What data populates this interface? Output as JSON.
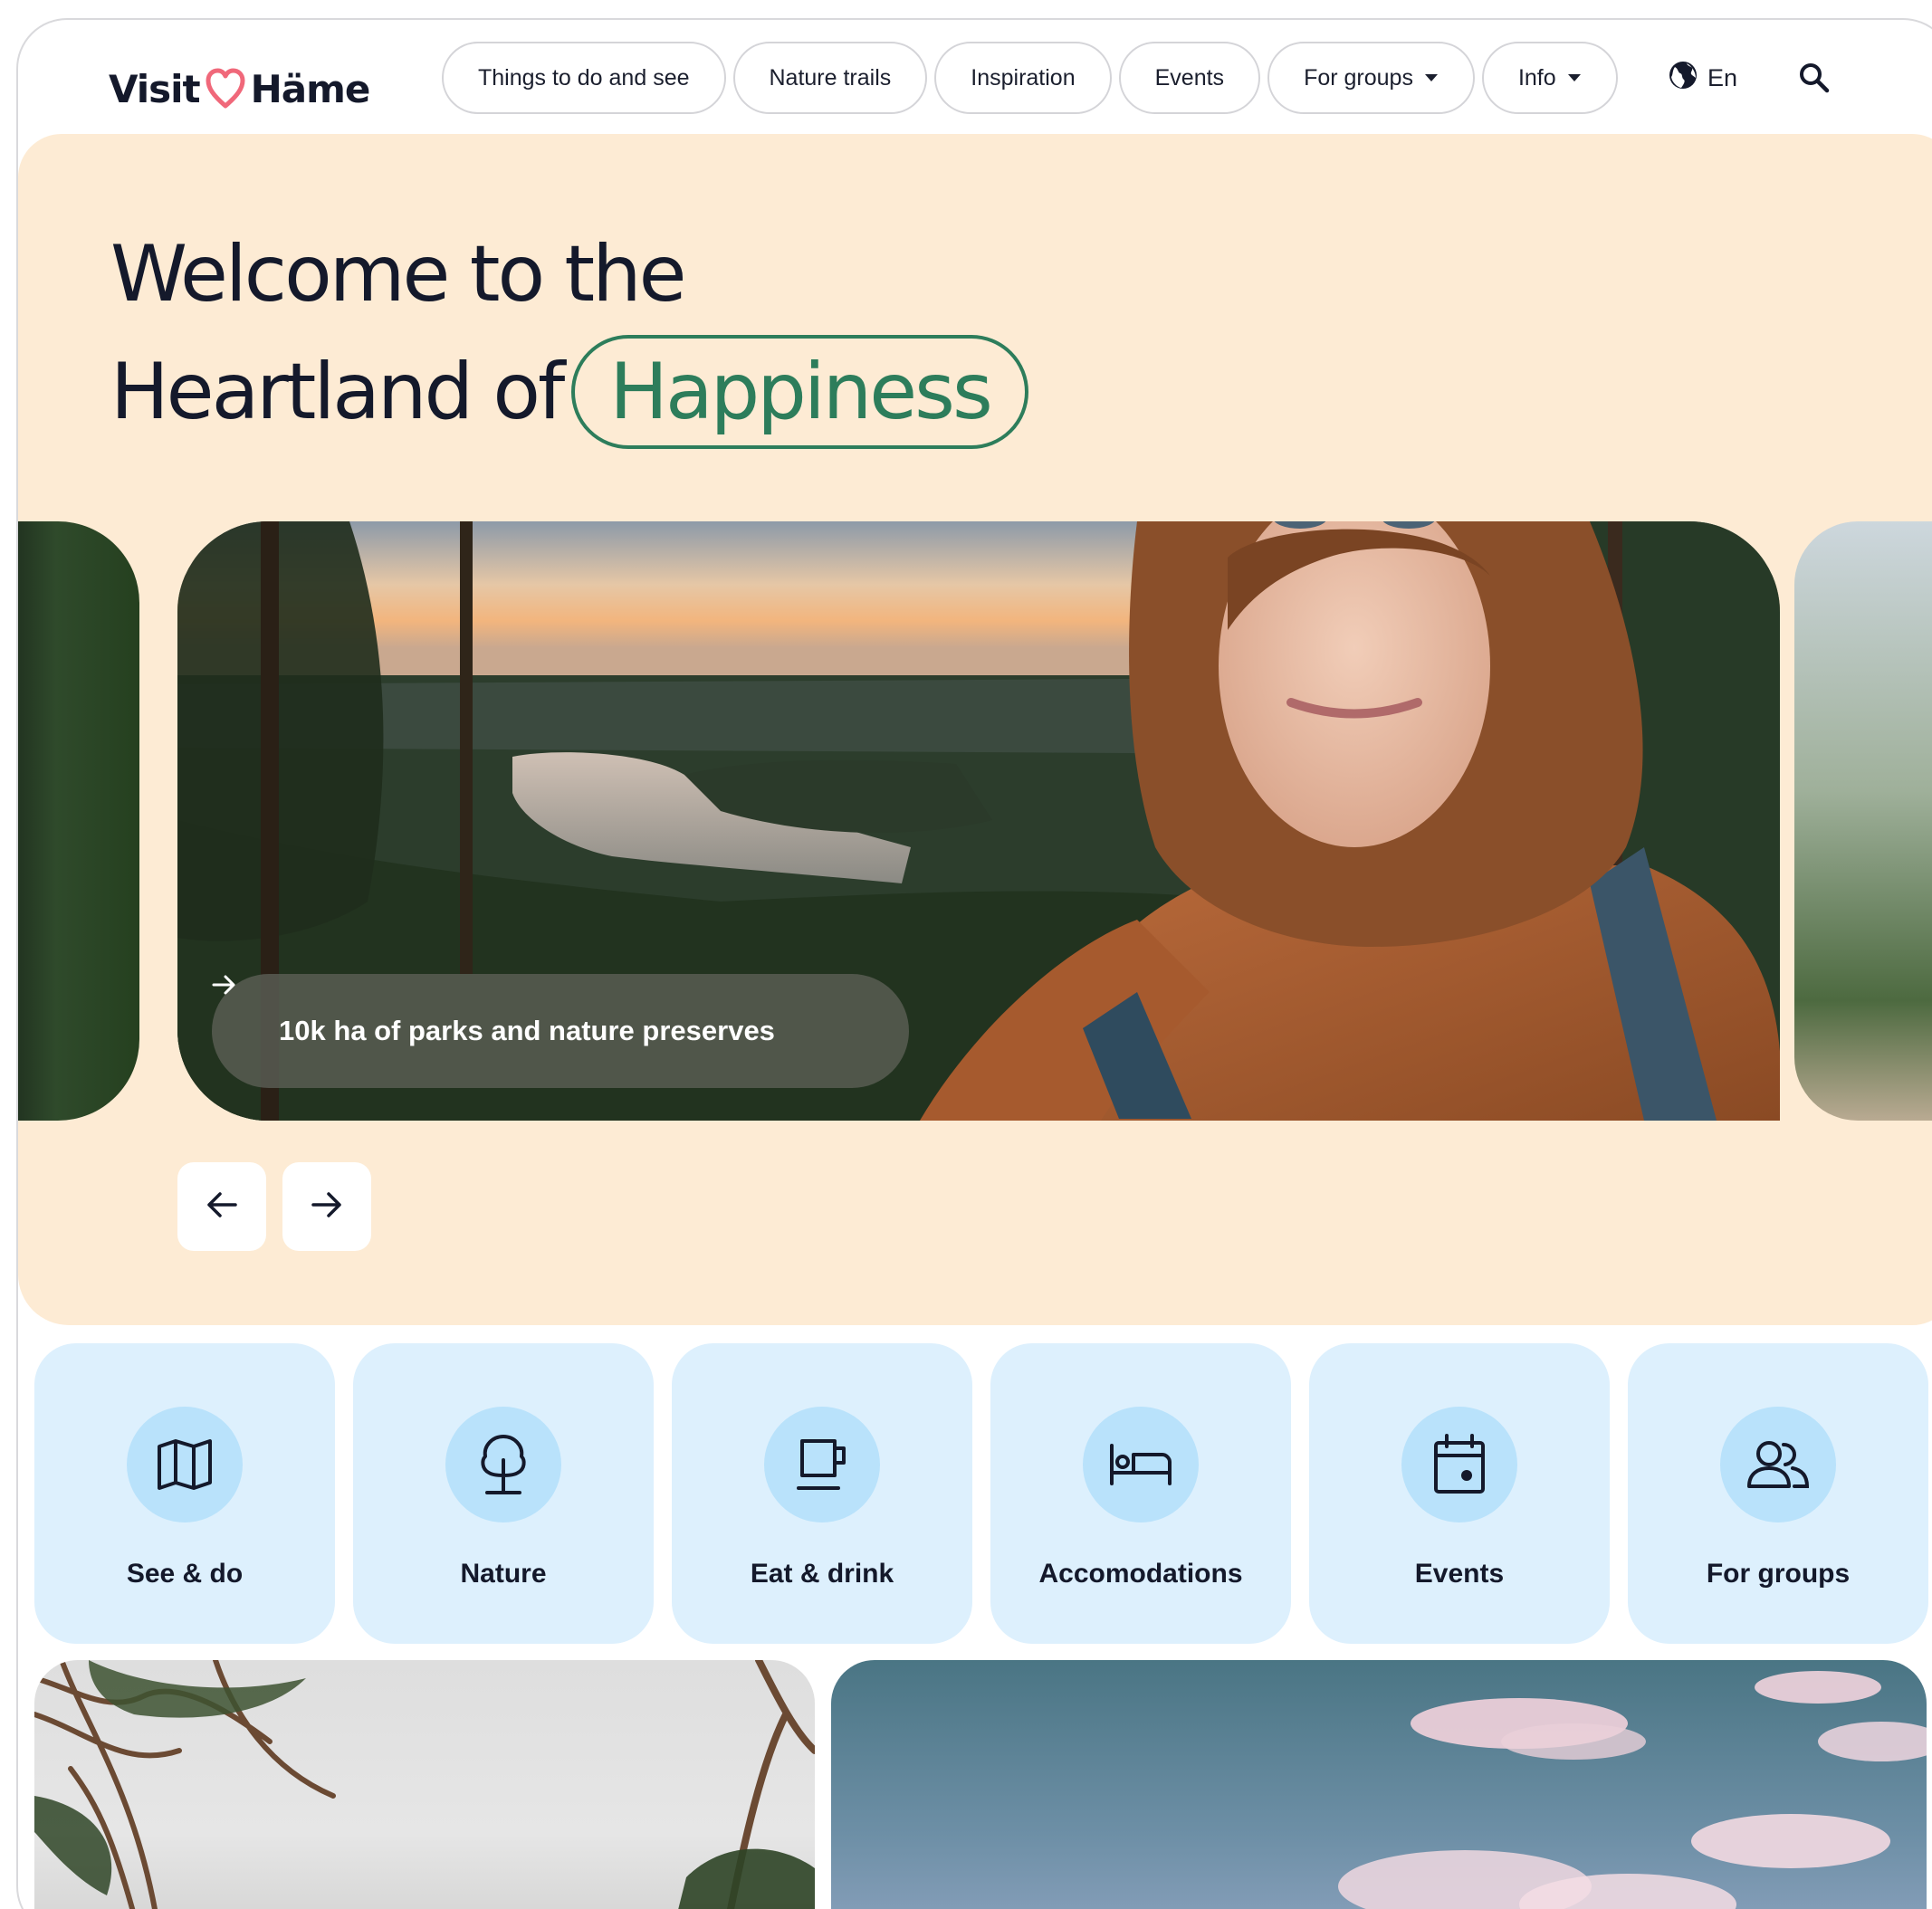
{
  "brand": {
    "logo_part1": "Visit",
    "logo_part2": "Häme",
    "heart_color": "#f0687a"
  },
  "nav": {
    "items": [
      {
        "label": "Things to do and see"
      },
      {
        "label": "Nature trails"
      },
      {
        "label": "Inspiration"
      },
      {
        "label": "Events"
      },
      {
        "label": "For groups",
        "has_dropdown": true
      },
      {
        "label": "Info",
        "has_dropdown": true
      }
    ],
    "language": "En",
    "language_icon": "globe-icon",
    "search_icon": "search-icon"
  },
  "hero": {
    "title_line1": "Welcome to the",
    "title_line2": "Heartland of",
    "title_highlight": "Happiness",
    "background_color": "#fdebd4",
    "highlight_color": "#2d7d5b",
    "slide_caption": "10k ha of parks and nature preserves",
    "slide_caption_icon": "arrow-right-icon",
    "prev_icon": "arrow-left-icon",
    "next_icon": "arrow-right-icon"
  },
  "categories": [
    {
      "label": "See & do",
      "icon": "map-icon"
    },
    {
      "label": "Nature",
      "icon": "tree-icon"
    },
    {
      "label": "Eat & drink",
      "icon": "coffee-cup-icon"
    },
    {
      "label": "Accomodations",
      "icon": "bed-icon"
    },
    {
      "label": "Events",
      "icon": "calendar-icon"
    },
    {
      "label": "For groups",
      "icon": "group-icon"
    }
  ],
  "colors": {
    "category_bg": "#ddf0fd",
    "category_icon_bg": "#b9e2fb",
    "text_dark": "#14192b"
  }
}
